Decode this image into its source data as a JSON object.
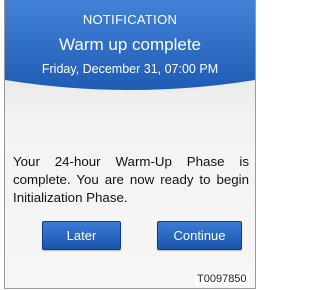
{
  "notification": {
    "header": "NOTIFICATION",
    "subject": "Warm up complete",
    "date": "Friday, December 31, 07:00 PM",
    "message": "Your 24-hour Warm-Up Phase is complete. You are now ready to begin Initialization Phase."
  },
  "buttons": {
    "later": "Later",
    "continue": "Continue"
  },
  "figure_code": "T0097850",
  "colors": {
    "banner_top": "#3f7fd6",
    "banner_bottom": "#1f5cb5",
    "button": "#2863c4"
  }
}
